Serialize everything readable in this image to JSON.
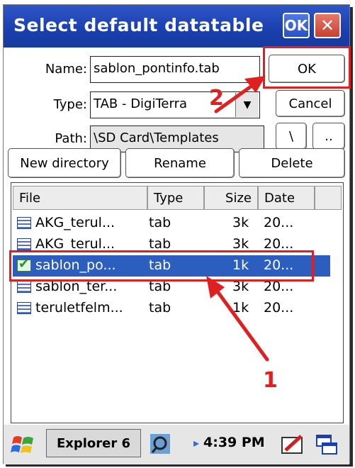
{
  "dialog": {
    "title": "Select default datatable",
    "ok_title": "OK",
    "close_glyph": "✕",
    "name_label": "Name:",
    "name_value": "sablon_pontinfo.tab",
    "type_label": "Type:",
    "type_value": "TAB - DigiTerra",
    "path_label": "Path:",
    "path_value": "\\SD Card\\Templates",
    "ok_label": "OK",
    "cancel_label": "Cancel",
    "root_label": "\\",
    "up_label": "..",
    "new_directory_label": "New directory",
    "rename_label": "Rename",
    "delete_label": "Delete"
  },
  "list": {
    "columns": [
      "File",
      "Type",
      "Size",
      "Date"
    ],
    "rows": [
      {
        "file": "AKG_terul...",
        "type": "tab",
        "size": "3k",
        "date": "20...",
        "selected": false
      },
      {
        "file": "AKG_terul...",
        "type": "tab",
        "size": "3k",
        "date": "20...",
        "selected": false
      },
      {
        "file": "sablon_po...",
        "type": "tab",
        "size": "1k",
        "date": "20...",
        "selected": true
      },
      {
        "file": "sablon_ter...",
        "type": "tab",
        "size": "3k",
        "date": "20...",
        "selected": false
      },
      {
        "file": "teruletfelm...",
        "type": "tab",
        "size": "1k",
        "date": "20...",
        "selected": false
      }
    ]
  },
  "annotations": {
    "marker_1": "1",
    "marker_2": "2",
    "color": "#e02020"
  },
  "taskbar": {
    "app_label": "Explorer 6",
    "time": "4:39 PM",
    "speaker_glyph": "▸"
  },
  "colors": {
    "title_bar": "#1a3fae",
    "selection": "#2c5ebf"
  }
}
